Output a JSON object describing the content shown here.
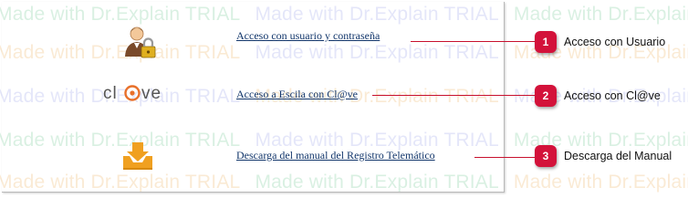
{
  "watermark_text": "Made with Dr.Explain TRIAL",
  "rows": [
    {
      "icon": "user-lock-icon",
      "link": "Acceso con usuario y contraseña"
    },
    {
      "icon": "clave-logo",
      "link": "Acceso a Escila con Cl@ve",
      "logo_text": "cl@ve"
    },
    {
      "icon": "download-tray-icon",
      "link": "Descarga del manual del Registro Telemático"
    }
  ],
  "callouts": [
    {
      "number": "1",
      "label": "Acceso con Usuario"
    },
    {
      "number": "2",
      "label": "Acceso con Cl@ve"
    },
    {
      "number": "3",
      "label": "Descarga del Manual"
    }
  ],
  "colors": {
    "link": "#12366b",
    "callout": "#d3123a",
    "download_icon": "#f0a020",
    "clave_orange": "#e8702a"
  }
}
